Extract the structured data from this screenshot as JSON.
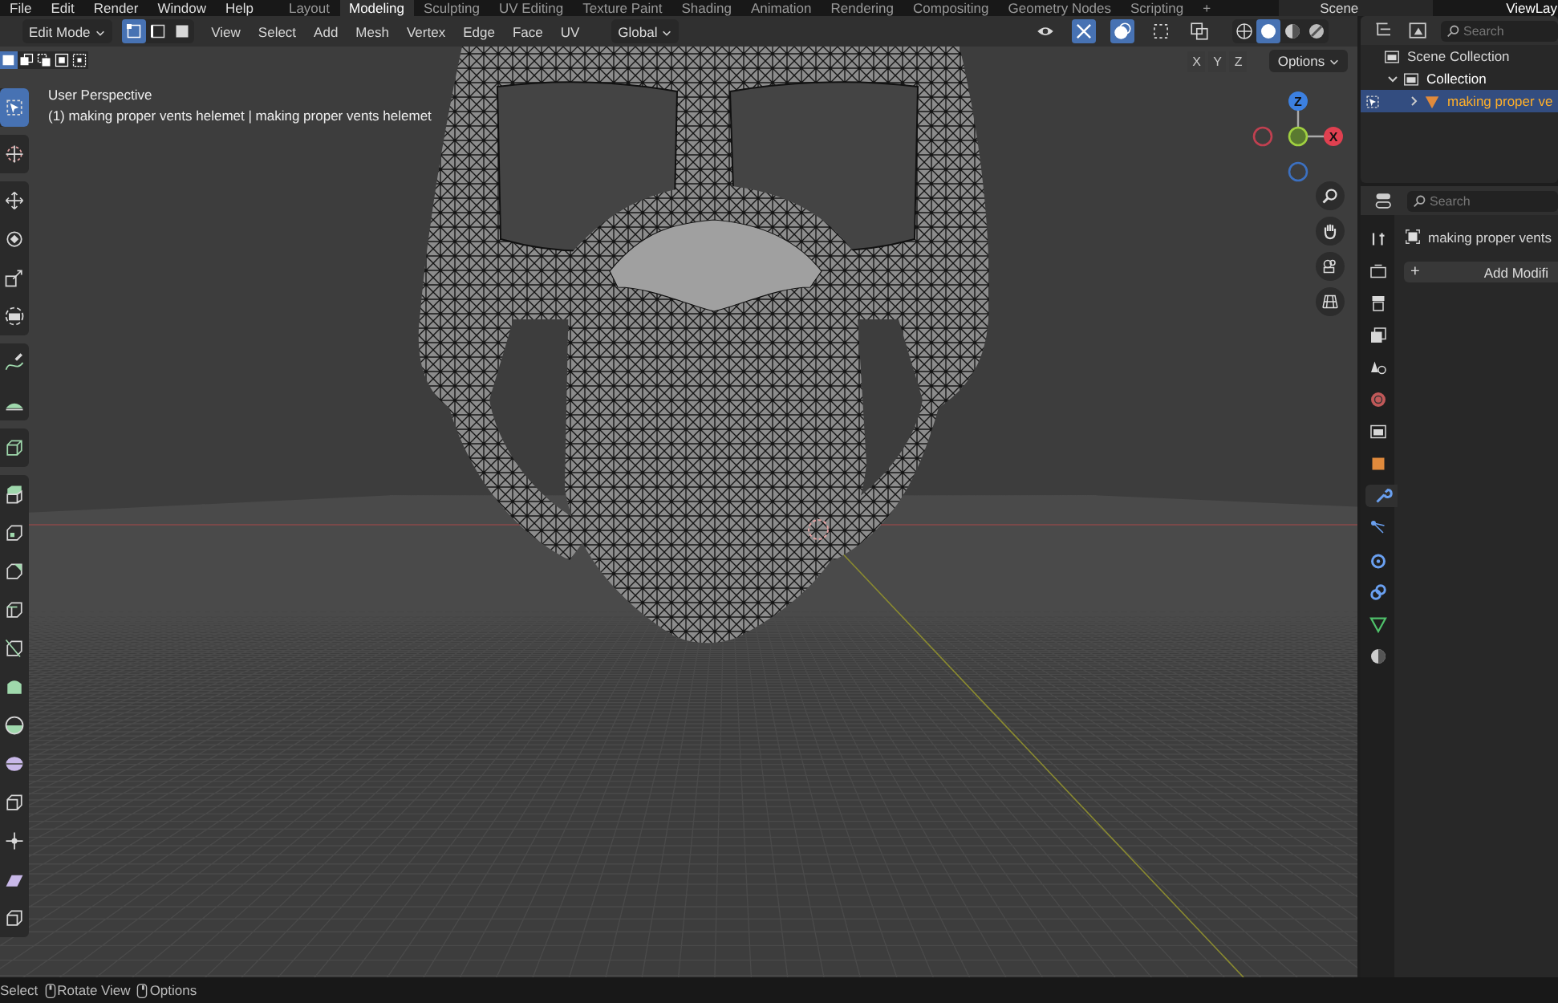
{
  "top_bar": {
    "menus": [
      "File",
      "Edit",
      "Render",
      "Window",
      "Help"
    ],
    "workspaces": [
      {
        "label": "Layout",
        "selected": false
      },
      {
        "label": "Modeling",
        "selected": true
      },
      {
        "label": "Sculpting",
        "selected": false
      },
      {
        "label": "UV Editing",
        "selected": false
      },
      {
        "label": "Texture Paint",
        "selected": false
      },
      {
        "label": "Shading",
        "selected": false
      },
      {
        "label": "Animation",
        "selected": false
      },
      {
        "label": "Rendering",
        "selected": false
      },
      {
        "label": "Compositing",
        "selected": false
      },
      {
        "label": "Geometry Nodes",
        "selected": false
      },
      {
        "label": "Scripting",
        "selected": false
      }
    ],
    "add_workspace": "+",
    "scene": "Scene",
    "view_layer": "ViewLay"
  },
  "header": {
    "mode": "Edit Mode",
    "select_modes": [
      {
        "kind": "vertex",
        "selected": true
      },
      {
        "kind": "edge",
        "selected": false
      },
      {
        "kind": "face",
        "selected": false
      }
    ],
    "menus": [
      "View",
      "Select",
      "Add",
      "Mesh",
      "Vertex",
      "Edge",
      "Face",
      "UV"
    ],
    "orientation": "Global",
    "toggles": [
      {
        "kind": "visibility",
        "on": false
      },
      {
        "kind": "gizmo",
        "on": true
      },
      {
        "kind": "overlay",
        "on": true
      },
      {
        "kind": "mesh-select",
        "on": false
      },
      {
        "kind": "xray",
        "on": false
      }
    ],
    "shading": [
      {
        "kind": "wireframe",
        "selected": false
      },
      {
        "kind": "solid",
        "selected": true
      },
      {
        "kind": "material",
        "selected": false
      },
      {
        "kind": "rendered",
        "selected": false
      }
    ]
  },
  "viewport": {
    "selection_ops": [
      {
        "kind": "new",
        "selected": true
      },
      {
        "kind": "extend",
        "selected": false
      },
      {
        "kind": "subtract",
        "selected": false
      },
      {
        "kind": "invert",
        "selected": false
      },
      {
        "kind": "intersect",
        "selected": false
      }
    ],
    "view_name": "User Perspective",
    "object_info": "(1) making proper vents helemet | making proper vents helemet",
    "axis_buttons": [
      "X",
      "Y",
      "Z"
    ],
    "options": "Options",
    "gizmo_z": "Z",
    "gizmo_x": "X",
    "tool_groups": [
      [
        {
          "kind": "select-box",
          "selected": true
        }
      ],
      [
        {
          "kind": "cursor",
          "selected": false
        }
      ],
      [
        {
          "kind": "move",
          "selected": false
        },
        {
          "kind": "rotate",
          "selected": false
        },
        {
          "kind": "scale",
          "selected": false
        },
        {
          "kind": "transform",
          "selected": false
        }
      ],
      [
        {
          "kind": "annotate",
          "selected": false
        },
        {
          "kind": "measure",
          "selected": false
        }
      ],
      [
        {
          "kind": "add-cube",
          "selected": false
        }
      ],
      [
        {
          "kind": "extrude",
          "selected": false
        },
        {
          "kind": "inset",
          "selected": false
        },
        {
          "kind": "bevel",
          "selected": false
        },
        {
          "kind": "loop-cut",
          "selected": false
        },
        {
          "kind": "knife",
          "selected": false
        },
        {
          "kind": "poly-build",
          "selected": false
        },
        {
          "kind": "spin",
          "selected": false
        },
        {
          "kind": "smooth",
          "selected": false
        },
        {
          "kind": "edge-slide",
          "selected": false
        },
        {
          "kind": "shrink",
          "selected": false
        },
        {
          "kind": "shear",
          "selected": false
        },
        {
          "kind": "rip",
          "selected": false
        }
      ]
    ]
  },
  "outliner": {
    "search_placeholder": "Search",
    "tree": [
      {
        "label": "Scene Collection",
        "kind": "collection",
        "selected": false,
        "children": [
          {
            "label": "Collection",
            "kind": "collection",
            "expanded": true,
            "selected": false,
            "children": [
              {
                "label": "making proper ve",
                "kind": "mesh",
                "expanded": false,
                "selected": true
              }
            ]
          }
        ]
      }
    ]
  },
  "properties": {
    "search_placeholder": "Search",
    "tabs": [
      {
        "kind": "tool",
        "selected": false
      },
      {
        "kind": "render",
        "selected": false
      },
      {
        "kind": "output",
        "selected": false
      },
      {
        "kind": "view-layer",
        "selected": false
      },
      {
        "kind": "scene",
        "selected": false
      },
      {
        "kind": "world",
        "selected": false
      },
      {
        "kind": "collection",
        "selected": false
      },
      {
        "kind": "object",
        "selected": false
      },
      {
        "kind": "modifier",
        "selected": true
      },
      {
        "kind": "particles",
        "selected": false
      },
      {
        "kind": "physics",
        "selected": false
      },
      {
        "kind": "constraints",
        "selected": false
      },
      {
        "kind": "data",
        "selected": false
      },
      {
        "kind": "material",
        "selected": false
      }
    ],
    "object_name": "making proper vents",
    "add_label": "+",
    "add_modifier": "Add Modifi"
  },
  "status_bar": [
    {
      "kind": "left",
      "label": "Select"
    },
    {
      "kind": "middle",
      "label": "Rotate View"
    },
    {
      "kind": "right",
      "label": "Options"
    }
  ]
}
